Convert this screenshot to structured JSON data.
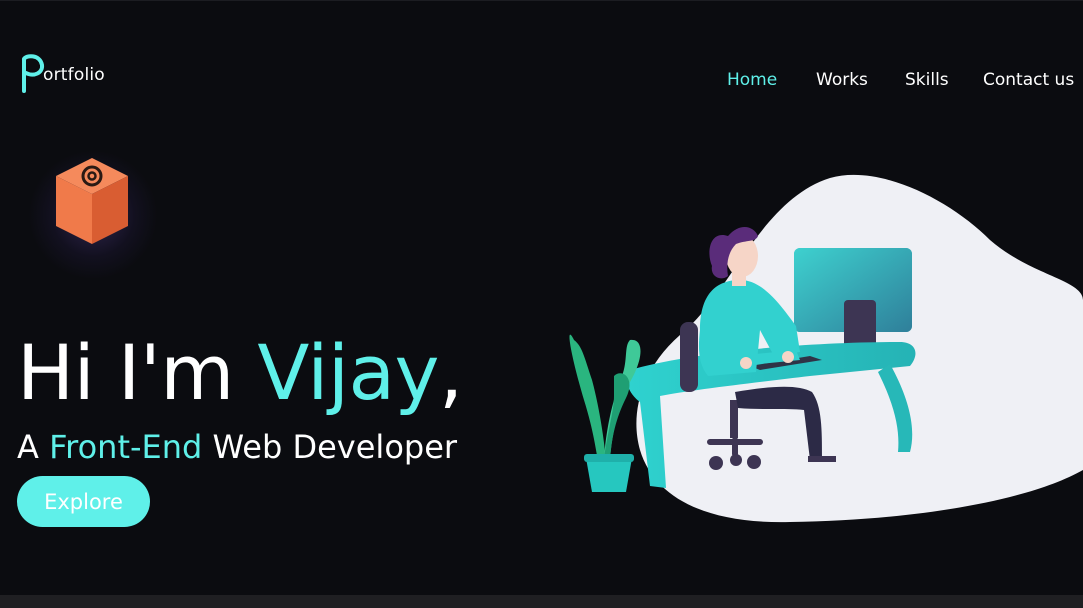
{
  "brand": {
    "logo_letter": "P",
    "logo_text": "ortfolio"
  },
  "nav": {
    "items": [
      "Home",
      "Works",
      "Skills",
      "Contact us"
    ],
    "active": "Home"
  },
  "hero": {
    "greeting_prefix": "Hi I'm ",
    "name": "Vijay",
    "greeting_suffix": ",",
    "subtitle_prefix": "A ",
    "subtitle_accent": "Front-End",
    "subtitle_suffix": " Web Developer",
    "cta_label": "Explore"
  },
  "icons": {
    "cube": "at-sign-cube-icon",
    "illustration": "developer-at-desk-illustration"
  },
  "colors": {
    "background": "#0b0c10",
    "accent": "#5ff0e9",
    "cube": "#f07a4a",
    "blob": "#eff0f5"
  }
}
